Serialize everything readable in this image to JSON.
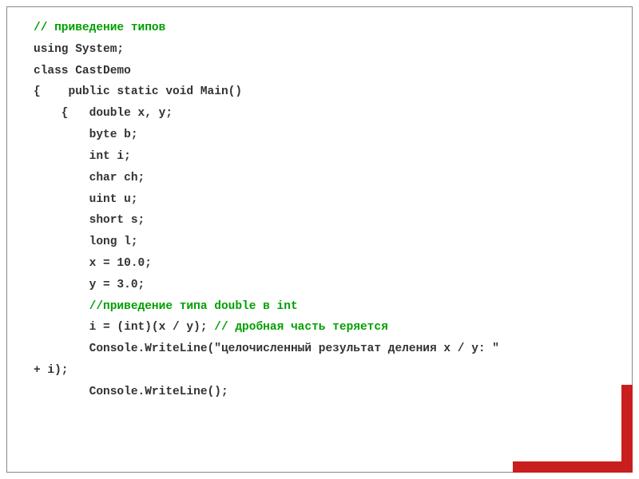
{
  "code": {
    "lines": [
      {
        "segments": [
          {
            "type": "comment",
            "text": "// приведение типов"
          }
        ]
      },
      {
        "segments": [
          {
            "type": "code",
            "text": "using System;"
          }
        ]
      },
      {
        "segments": [
          {
            "type": "code",
            "text": "class CastDemo"
          }
        ]
      },
      {
        "segments": [
          {
            "type": "code",
            "text": "{    public static void Main()"
          }
        ]
      },
      {
        "segments": [
          {
            "type": "code",
            "text": "    {   double x, y;"
          }
        ]
      },
      {
        "segments": [
          {
            "type": "code",
            "text": "        byte b;"
          }
        ]
      },
      {
        "segments": [
          {
            "type": "code",
            "text": "        int i;"
          }
        ]
      },
      {
        "segments": [
          {
            "type": "code",
            "text": "        char ch;"
          }
        ]
      },
      {
        "segments": [
          {
            "type": "code",
            "text": "        uint u;"
          }
        ]
      },
      {
        "segments": [
          {
            "type": "code",
            "text": "        short s;"
          }
        ]
      },
      {
        "segments": [
          {
            "type": "code",
            "text": "        long l;"
          }
        ]
      },
      {
        "segments": [
          {
            "type": "code",
            "text": "        x = 10.0;"
          }
        ]
      },
      {
        "segments": [
          {
            "type": "code",
            "text": "        y = 3.0;"
          }
        ]
      },
      {
        "segments": [
          {
            "type": "comment",
            "text": "        //приведение типа double в int"
          }
        ]
      },
      {
        "segments": [
          {
            "type": "code",
            "text": "        i = (int)(x / y); "
          },
          {
            "type": "comment",
            "text": "// дробная часть теряется"
          }
        ]
      },
      {
        "segments": [
          {
            "type": "code",
            "text": "        Console.WriteLine(\"целочисленный результат деления x / y: \" "
          }
        ]
      },
      {
        "segments": [
          {
            "type": "code",
            "text": "+ i);"
          }
        ]
      },
      {
        "segments": [
          {
            "type": "code",
            "text": "        Console.WriteLine();"
          }
        ]
      }
    ]
  }
}
